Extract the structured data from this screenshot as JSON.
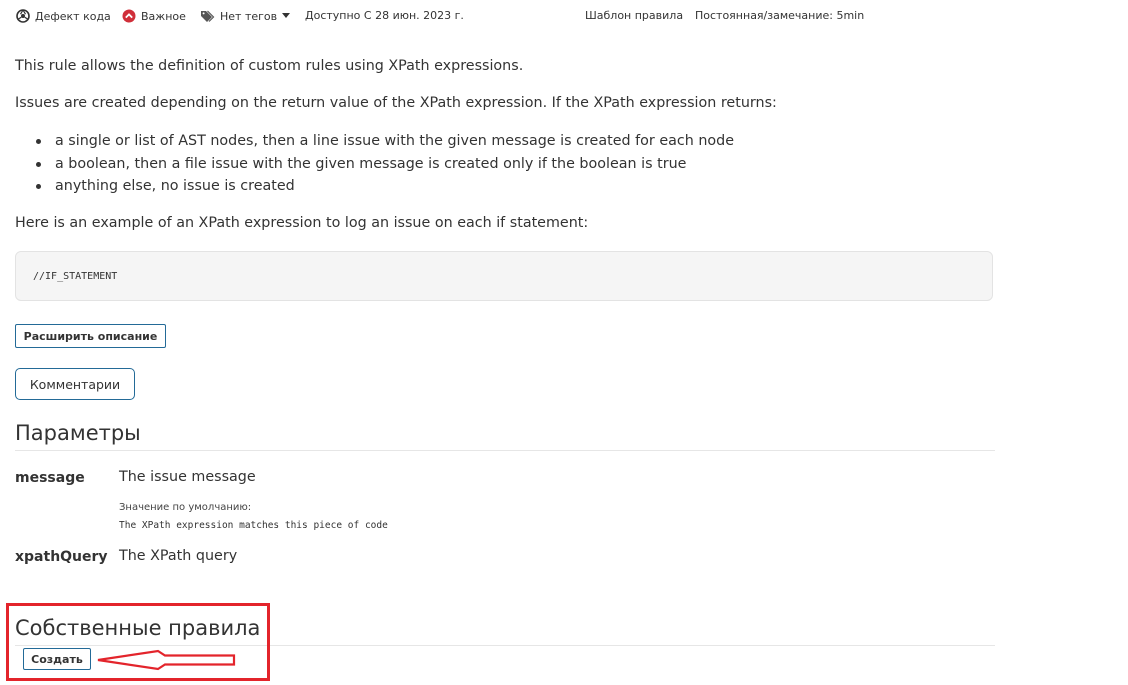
{
  "meta": {
    "type_label": "Дефект кода",
    "severity_label": "Важное",
    "tags_label": "Нет тегов",
    "available_label": "Доступно С 28 июн. 2023 г.",
    "template_label": "Шаблон правила",
    "effort_label": "Постоянная/замечание: 5min"
  },
  "description": {
    "p1": "This rule allows the definition of custom rules using XPath expressions.",
    "p2": "Issues are created depending on the return value of the XPath expression. If the XPath expression returns:",
    "bullets": [
      "a single or list of AST nodes, then a line issue with the given message is created for each node",
      "a boolean, then a file issue with the given message is created only if the boolean is true",
      "anything else, no issue is created"
    ],
    "p3": "Here is an example of an XPath expression to log an issue on each if statement:",
    "code": "//IF_STATEMENT"
  },
  "buttons": {
    "expand_label": "Расширить описание",
    "comments_label": "Комментарии",
    "create_label": "Создать"
  },
  "parameters": {
    "title": "Параметры",
    "items": [
      {
        "name": "message",
        "description": "The issue message",
        "default_label": "Значение по умолчанию:",
        "default_value": "The XPath expression matches this piece of code"
      },
      {
        "name": "xpathQuery",
        "description": "The XPath query"
      }
    ]
  },
  "custom_rules": {
    "title": "Собственные правила"
  },
  "colors": {
    "accent_border": "#236a97",
    "severity": "#d02f3a",
    "highlight": "#e3242b"
  }
}
